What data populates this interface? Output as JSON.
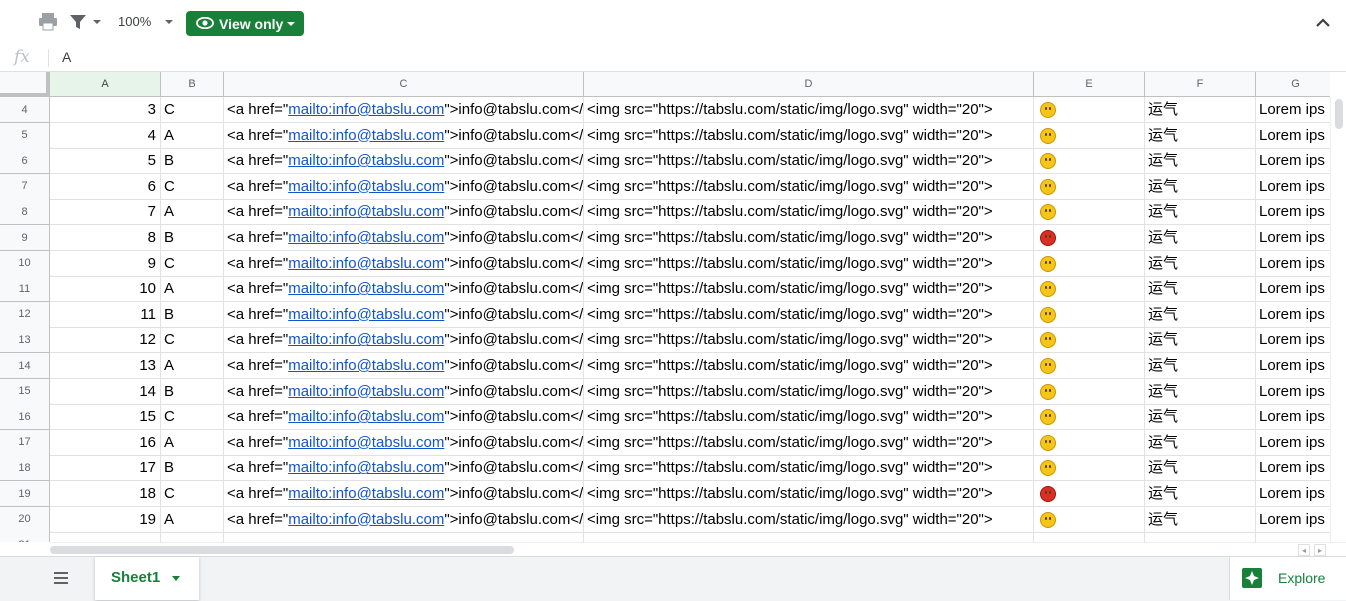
{
  "toolbar": {
    "zoom": "100%",
    "view_only_label": "View only",
    "print_icon": "printer-icon",
    "filter_icon": "filter-icon",
    "collapse_icon": "chevron-up-icon",
    "accent_color": "#188038"
  },
  "formula_bar": {
    "fx_label": "fx",
    "value": "A"
  },
  "columns": [
    "A",
    "B",
    "C",
    "D",
    "E",
    "F",
    "G"
  ],
  "rows": [
    {
      "row": "4",
      "a": "3",
      "b": "C",
      "c_pre": "<a href=\"",
      "c_link": "mailto:info@tabslu.com",
      "c_post": "\">info@tabslu.com</a",
      "d": "<img src=\"https://tabslu.com/static/img/logo.svg\" width=\"20\">",
      "e": "neutral-face-emoji",
      "f": "运气",
      "g": "Lorem ips"
    },
    {
      "row": "5",
      "a": "4",
      "b": "A",
      "c_pre": "<a href=\"",
      "c_link": "mailto:info@tabslu.com",
      "c_post": "\">info@tabslu.com</a",
      "d": "<img src=\"https://tabslu.com/static/img/logo.svg\" width=\"20\">",
      "e": "sunglasses-emoji",
      "f": "运气",
      "g": "Lorem ips"
    },
    {
      "row": "6",
      "a": "5",
      "b": "B",
      "c_pre": "<a href=\"",
      "c_link": "mailto:info@tabslu.com",
      "c_post": "\">info@tabslu.com</a",
      "d": "<img src=\"https://tabslu.com/static/img/logo.svg\" width=\"20\">",
      "e": "smile-emoji",
      "f": "运气",
      "g": "Lorem ips"
    },
    {
      "row": "7",
      "a": "6",
      "b": "C",
      "c_pre": "<a href=\"",
      "c_link": "mailto:info@tabslu.com",
      "c_post": "\">info@tabslu.com</a",
      "d": "<img src=\"https://tabslu.com/static/img/logo.svg\" width=\"20\">",
      "e": "nerd-emoji",
      "f": "运气",
      "g": "Lorem ips"
    },
    {
      "row": "8",
      "a": "7",
      "b": "A",
      "c_pre": "<a href=\"",
      "c_link": "mailto:info@tabslu.com",
      "c_post": "\">info@tabslu.com</a",
      "d": "<img src=\"https://tabslu.com/static/img/logo.svg\" width=\"20\">",
      "e": "surprised-emoji",
      "f": "运气",
      "g": "Lorem ips"
    },
    {
      "row": "9",
      "a": "8",
      "b": "B",
      "c_pre": "<a href=\"",
      "c_link": "mailto:info@tabslu.com",
      "c_post": "\">info@tabslu.com</a",
      "d": "<img src=\"https://tabslu.com/static/img/logo.svg\" width=\"20\">",
      "e": "devil-emoji",
      "f": "运气",
      "g": "Lorem ips"
    },
    {
      "row": "10",
      "a": "9",
      "b": "C",
      "c_pre": "<a href=\"",
      "c_link": "mailto:info@tabslu.com",
      "c_post": "\">info@tabslu.com</a",
      "d": "<img src=\"https://tabslu.com/static/img/logo.svg\" width=\"20\">",
      "e": "tongue-emoji",
      "f": "运气",
      "g": "Lorem ips"
    },
    {
      "row": "11",
      "a": "10",
      "b": "A",
      "c_pre": "<a href=\"",
      "c_link": "mailto:info@tabslu.com",
      "c_post": "\">info@tabslu.com</a",
      "d": "<img src=\"https://tabslu.com/static/img/logo.svg\" width=\"20\">",
      "e": "hushed-emoji",
      "f": "运气",
      "g": "Lorem ips"
    },
    {
      "row": "12",
      "a": "11",
      "b": "B",
      "c_pre": "<a href=\"",
      "c_link": "mailto:info@tabslu.com",
      "c_post": "\">info@tabslu.com</a",
      "d": "<img src=\"https://tabslu.com/static/img/logo.svg\" width=\"20\">",
      "e": "grin-emoji",
      "f": "运气",
      "g": "Lorem ips"
    },
    {
      "row": "13",
      "a": "12",
      "b": "C",
      "c_pre": "<a href=\"",
      "c_link": "mailto:info@tabslu.com",
      "c_post": "\">info@tabslu.com</a",
      "d": "<img src=\"https://tabslu.com/static/img/logo.svg\" width=\"20\">",
      "e": "smile-emoji",
      "f": "运气",
      "g": "Lorem ips"
    },
    {
      "row": "14",
      "a": "13",
      "b": "A",
      "c_pre": "<a href=\"",
      "c_link": "mailto:info@tabslu.com",
      "c_post": "\">info@tabslu.com</a",
      "d": "<img src=\"https://tabslu.com/static/img/logo.svg\" width=\"20\">",
      "e": "neutral-face-emoji",
      "f": "运气",
      "g": "Lorem ips"
    },
    {
      "row": "15",
      "a": "14",
      "b": "B",
      "c_pre": "<a href=\"",
      "c_link": "mailto:info@tabslu.com",
      "c_post": "\">info@tabslu.com</a",
      "d": "<img src=\"https://tabslu.com/static/img/logo.svg\" width=\"20\">",
      "e": "sunglasses-emoji",
      "f": "运气",
      "g": "Lorem ips"
    },
    {
      "row": "16",
      "a": "15",
      "b": "C",
      "c_pre": "<a href=\"",
      "c_link": "mailto:info@tabslu.com",
      "c_post": "\">info@tabslu.com</a",
      "d": "<img src=\"https://tabslu.com/static/img/logo.svg\" width=\"20\">",
      "e": "smile-emoji",
      "f": "运气",
      "g": "Lorem ips"
    },
    {
      "row": "17",
      "a": "16",
      "b": "A",
      "c_pre": "<a href=\"",
      "c_link": "mailto:info@tabslu.com",
      "c_post": "\">info@tabslu.com</a",
      "d": "<img src=\"https://tabslu.com/static/img/logo.svg\" width=\"20\">",
      "e": "nerd-emoji",
      "f": "运气",
      "g": "Lorem ips"
    },
    {
      "row": "18",
      "a": "17",
      "b": "B",
      "c_pre": "<a href=\"",
      "c_link": "mailto:info@tabslu.com",
      "c_post": "\">info@tabslu.com</a",
      "d": "<img src=\"https://tabslu.com/static/img/logo.svg\" width=\"20\">",
      "e": "surprised-emoji",
      "f": "运气",
      "g": "Lorem ips"
    },
    {
      "row": "19",
      "a": "18",
      "b": "C",
      "c_pre": "<a href=\"",
      "c_link": "mailto:info@tabslu.com",
      "c_post": "\">info@tabslu.com</a",
      "d": "<img src=\"https://tabslu.com/static/img/logo.svg\" width=\"20\">",
      "e": "devil-emoji",
      "f": "运气",
      "g": "Lorem ips"
    },
    {
      "row": "20",
      "a": "19",
      "b": "A",
      "c_pre": "<a href=\"",
      "c_link": "mailto:info@tabslu.com",
      "c_post": "\">info@tabslu.com</a",
      "d": "<img src=\"https://tabslu.com/static/img/logo.svg\" width=\"20\">",
      "e": "tongue-emoji",
      "f": "运气",
      "g": "Lorem ips"
    },
    {
      "row": "21",
      "a": "",
      "b": "",
      "c_pre": "",
      "c_link": "",
      "c_post": "",
      "d": "",
      "e": "",
      "f": "",
      "g": ""
    }
  ],
  "bottom": {
    "sheet_tab": "Sheet1",
    "explore_label": "Explore",
    "sheets_menu_icon": "menu-icon",
    "explore_icon": "explore-icon"
  }
}
